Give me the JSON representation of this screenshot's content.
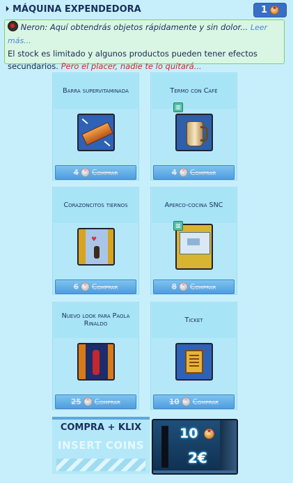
{
  "header": {
    "title": "MÁQUINA EXPENDEDORA",
    "coins": "1",
    "coin_icon": "coin-icon"
  },
  "info": {
    "speaker": "Neron:",
    "quote": "Aquí obtendrás objetos rápidamente y sin dolor...",
    "more_link": "Leer más...",
    "body": "El stock es limitado y algunos productos pueden tener efectos secundarios.",
    "red_text": "Pero el placer, nadie te lo quitará..."
  },
  "products": [
    {
      "name": "Barra supervitaminada",
      "price": "4",
      "buy_label": "Comprar",
      "icon": "energy-bar-icon",
      "tag": ""
    },
    {
      "name": "Termo con Café",
      "price": "4",
      "buy_label": "Comprar",
      "icon": "coffee-thermos-icon",
      "tag": "🂠"
    },
    {
      "name": "Corazoncitos tiernos",
      "price": "6",
      "buy_label": "Comprar",
      "icon": "hearts-look-icon",
      "tag": ""
    },
    {
      "name": "Aperco-cocina SNC",
      "price": "8",
      "buy_label": "Comprar",
      "icon": "kitchen-item-icon",
      "tag": "🂠"
    },
    {
      "name": "Nuevo look para Paola Rinaldo",
      "price": "25",
      "buy_label": "Comprar",
      "icon": "paola-look-icon",
      "tag": ""
    },
    {
      "name": "Ticket",
      "price": "10",
      "buy_label": "Comprar",
      "icon": "ticket-icon",
      "tag": ""
    }
  ],
  "klix_banner": {
    "title": "COMPRA + KLIX",
    "subtitle": "INSERT COINS"
  },
  "offer": {
    "amount": "10",
    "price": "2€"
  }
}
